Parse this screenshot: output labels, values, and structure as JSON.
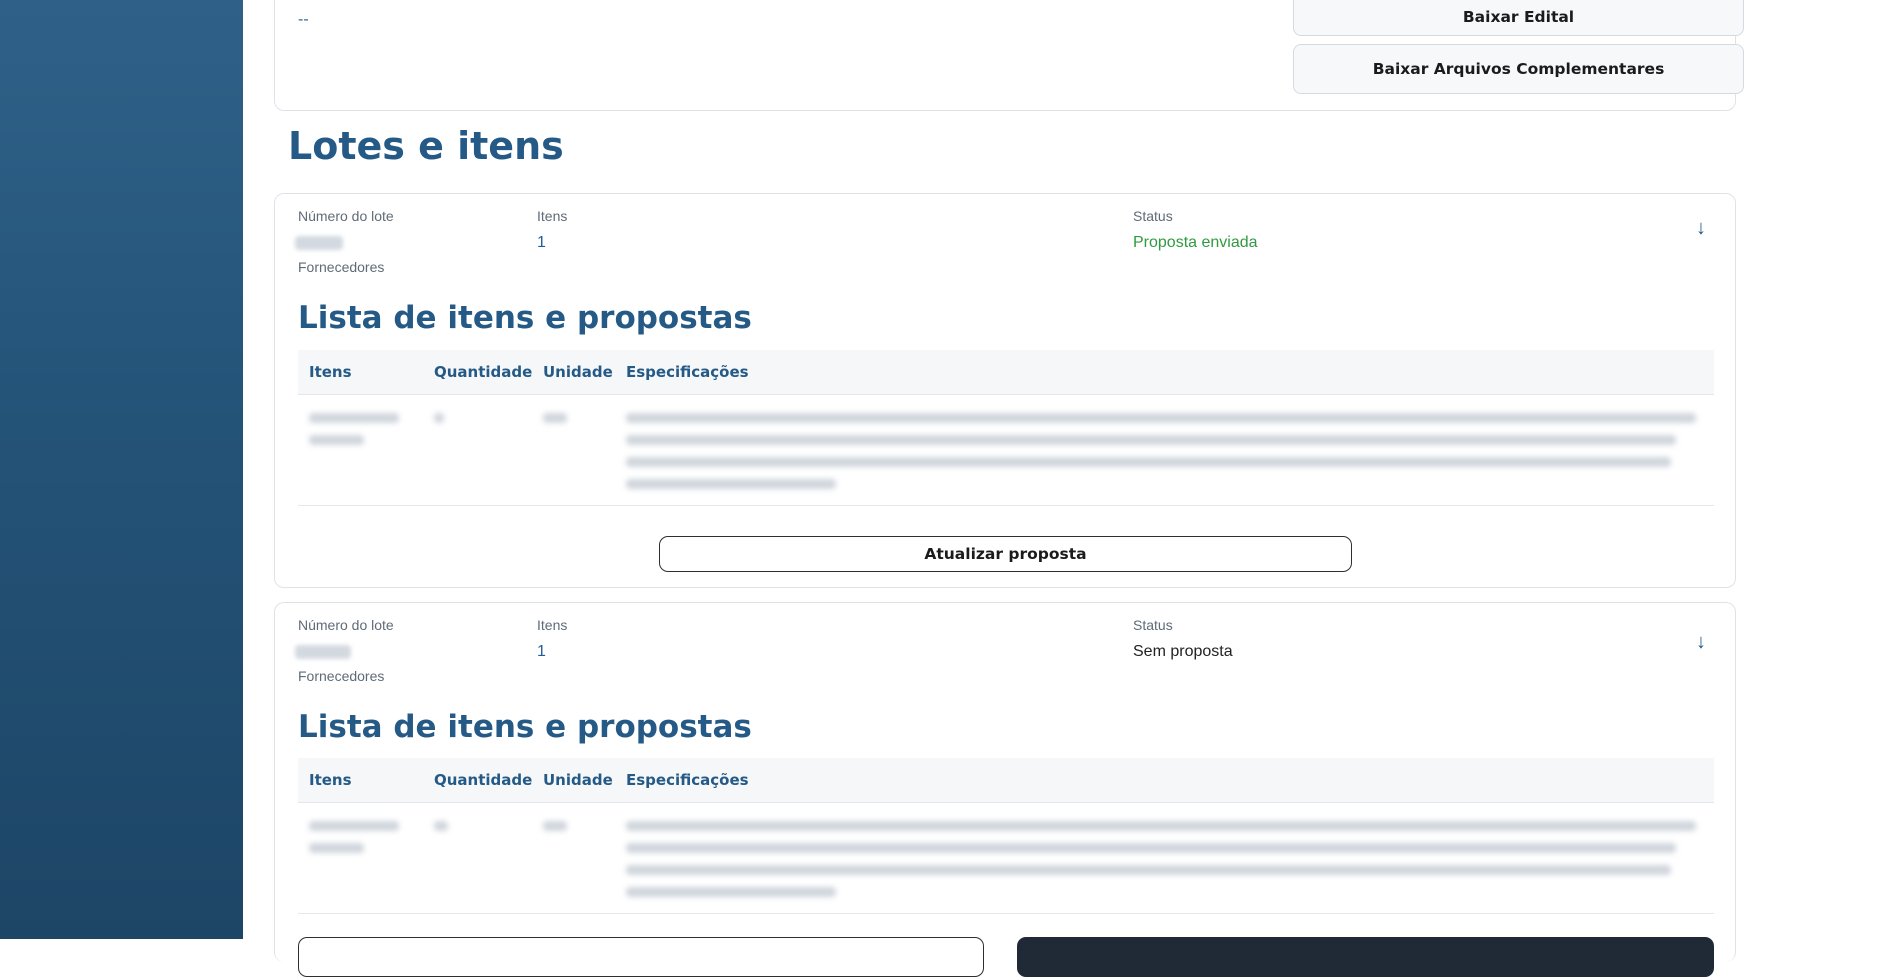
{
  "top": {
    "dash": "--",
    "baixar_edital": "Baixar Edital",
    "baixar_arquivos": "Baixar Arquivos Complementares"
  },
  "section_title": "Lotes e itens",
  "lotes": [
    {
      "label_numero": "Número do lote",
      "label_itens": "Itens",
      "itens_value": "1",
      "label_status": "Status",
      "status_value": "Proposta enviada",
      "label_fornecedores": "Fornecedores",
      "list_title": "Lista de itens e propostas",
      "columns": [
        "Itens",
        "Quantidade",
        "Unidade",
        "Especificações"
      ],
      "action_button": "Atualizar proposta"
    },
    {
      "label_numero": "Número do lote",
      "label_itens": "Itens",
      "itens_value": "1",
      "label_status": "Status",
      "status_value": "Sem proposta",
      "label_fornecedores": "Fornecedores",
      "list_title": "Lista de itens e propostas",
      "columns": [
        "Itens",
        "Quantidade",
        "Unidade",
        "Especificações"
      ]
    }
  ],
  "colors": {
    "sidebar": "#245378",
    "title": "#255a86",
    "status_sent": "#2f9a41"
  },
  "icons": {
    "expand": "arrow-down-icon"
  }
}
